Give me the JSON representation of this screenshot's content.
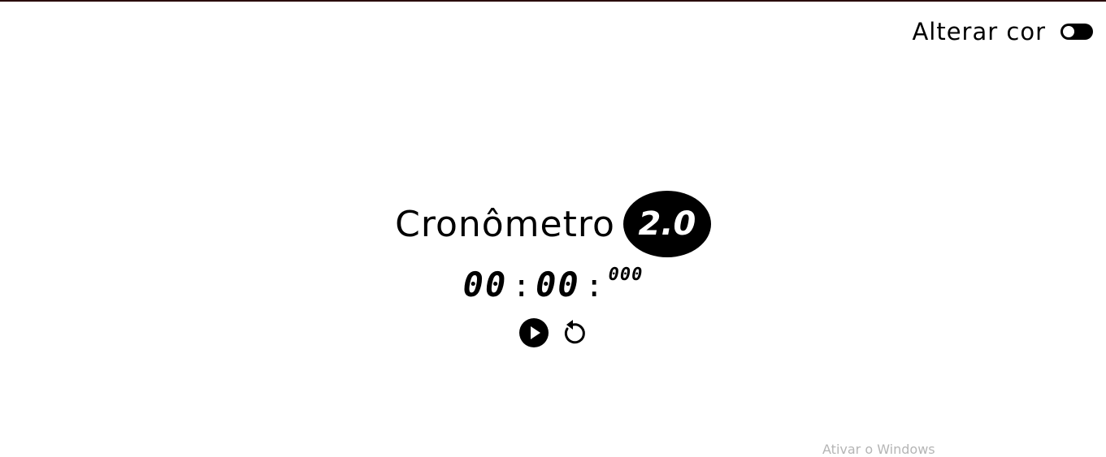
{
  "toggle": {
    "label": "Alterar cor"
  },
  "header": {
    "title": "Cronômetro",
    "version": "2.0"
  },
  "timer": {
    "minutes": "00",
    "separator1": ":",
    "seconds": "00",
    "separator2": ":",
    "milliseconds": "000"
  },
  "controls": {
    "play_icon": "play-circle-icon",
    "reset_icon": "reset-icon"
  },
  "watermark": {
    "text": "Ativar o Windows"
  },
  "colors": {
    "background": "#ffffff",
    "foreground": "#000000"
  }
}
